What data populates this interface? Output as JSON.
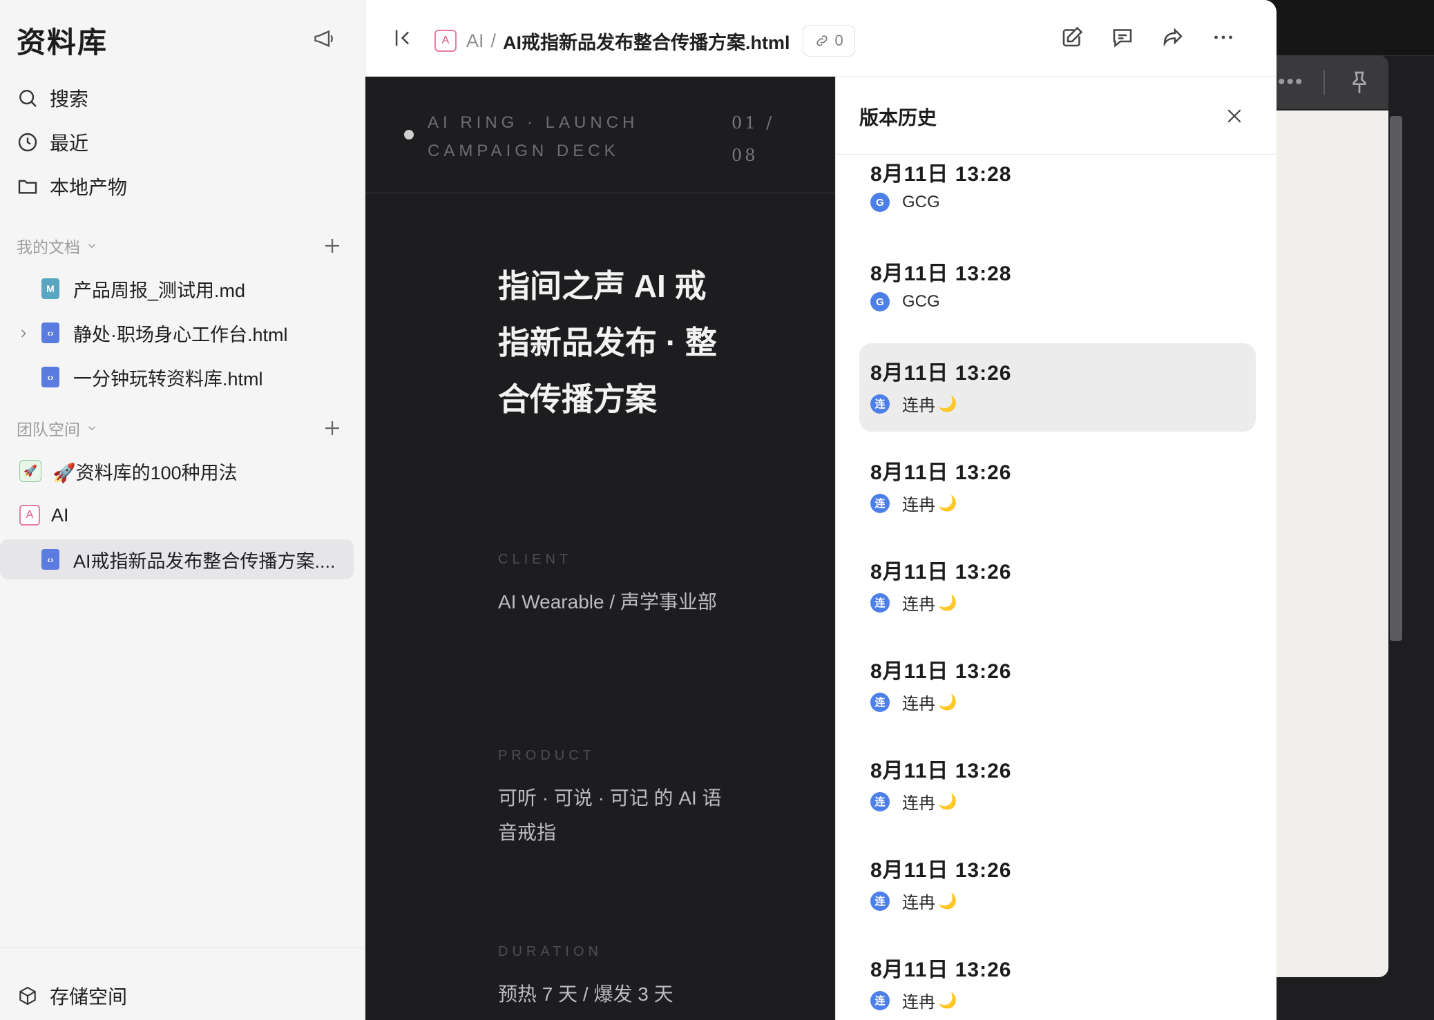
{
  "sidebar": {
    "title": "资料库",
    "nav": [
      {
        "label": "搜索",
        "icon": "search-icon"
      },
      {
        "label": "最近",
        "icon": "clock-icon"
      },
      {
        "label": "本地产物",
        "icon": "folder-icon"
      }
    ],
    "my_docs": {
      "label": "我的文档",
      "items": [
        {
          "label": "产品周报_测试用.md",
          "icon": "markdown-file-icon"
        },
        {
          "label": "静处·职场身心工作台.html",
          "icon": "html-file-icon"
        },
        {
          "label": "一分钟玩转资料库.html",
          "icon": "html-file-icon"
        }
      ]
    },
    "team_space": {
      "label": "团队空间",
      "items": [
        {
          "label": "🚀资料库的100种用法",
          "icon": "rocket-icon"
        },
        {
          "label": "AI",
          "icon": "ai-badge-icon"
        },
        {
          "label": "AI戒指新品发布整合传播方案....",
          "icon": "html-file-icon"
        }
      ]
    },
    "footer": {
      "label": "存储空间",
      "icon": "cube-icon"
    }
  },
  "header": {
    "breadcrumb_space_badge": "A",
    "breadcrumb_space": "AI",
    "breadcrumb_sep": "/",
    "breadcrumb_doc": "AI戒指新品发布整合传播方案.html",
    "link_count": "0"
  },
  "deck": {
    "label": "AI RING · LAUNCH CAMPAIGN DECK",
    "page": "01 / 08",
    "title": "指间之声 AI 戒指新品发布 · 整合传播方案",
    "fields": [
      {
        "label": "CLIENT",
        "value": "AI Wearable / 声学事业部"
      },
      {
        "label": "PRODUCT",
        "value": "可听 · 可说 · 可记 的 AI 语音戒指"
      },
      {
        "label": "DURATION",
        "value": "预热 7 天 / 爆发 3 天"
      }
    ]
  },
  "history": {
    "title": "版本历史",
    "versions": [
      {
        "time": "8月11日 13:28",
        "user": "GCG",
        "avatar": "G",
        "moon": ""
      },
      {
        "time": "8月11日 13:28",
        "user": "GCG",
        "avatar": "G",
        "moon": ""
      },
      {
        "time": "8月11日 13:26",
        "user": "连冉",
        "avatar": "连",
        "moon": "🌙",
        "selected": true
      },
      {
        "time": "8月11日 13:26",
        "user": "连冉",
        "avatar": "连",
        "moon": "🌙"
      },
      {
        "time": "8月11日 13:26",
        "user": "连冉",
        "avatar": "连",
        "moon": "🌙"
      },
      {
        "time": "8月11日 13:26",
        "user": "连冉",
        "avatar": "连",
        "moon": "🌙"
      },
      {
        "time": "8月11日 13:26",
        "user": "连冉",
        "avatar": "连",
        "moon": "🌙"
      },
      {
        "time": "8月11日 13:26",
        "user": "连冉",
        "avatar": "连",
        "moon": "🌙"
      },
      {
        "time": "8月11日 13:26",
        "user": "连冉",
        "avatar": "连",
        "moon": "🌙"
      }
    ]
  },
  "colors": {
    "accent_blue": "#4d7fe8",
    "ai_pink": "#e24c87",
    "deck_bg": "#1d1d1f"
  }
}
